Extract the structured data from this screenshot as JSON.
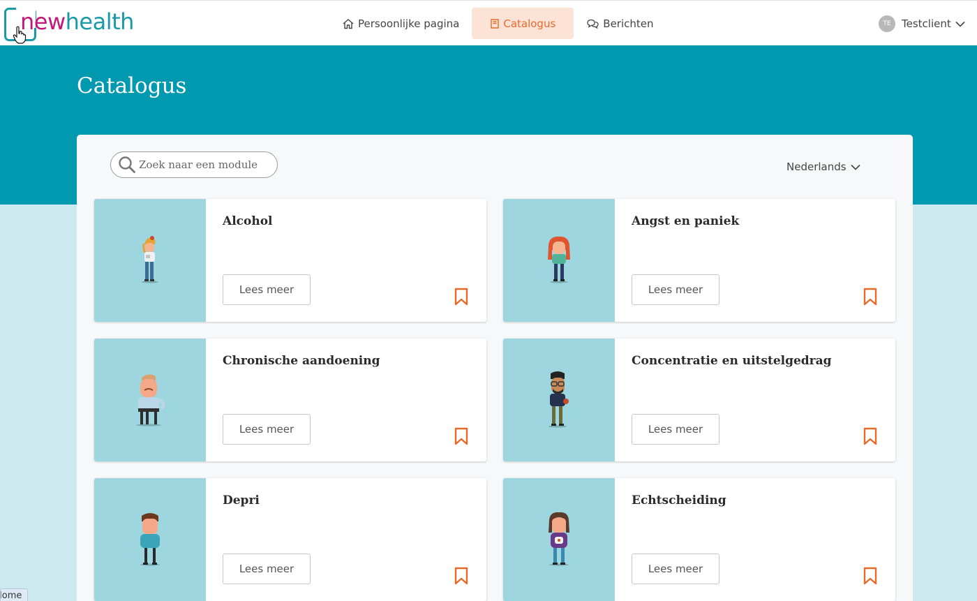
{
  "brand": {
    "part1": "new",
    "part2": "health"
  },
  "nav": [
    {
      "label": "Persoonlijke pagina",
      "icon": "home-icon"
    },
    {
      "label": "Catalogus",
      "icon": "book-icon",
      "active": true
    },
    {
      "label": "Berichten",
      "icon": "chat-icon"
    }
  ],
  "user": {
    "initials": "TE",
    "name": "Testclient"
  },
  "page": {
    "title": "Catalogus"
  },
  "search": {
    "placeholder": "Zoek naar een module"
  },
  "language": {
    "selected": "Nederlands"
  },
  "modules": [
    {
      "title": "Alcohol",
      "button": "Lees meer"
    },
    {
      "title": "Angst en paniek",
      "button": "Lees meer"
    },
    {
      "title": "Chronische aandoening",
      "button": "Lees meer"
    },
    {
      "title": "Concentratie en uitstelgedrag",
      "button": "Lees meer"
    },
    {
      "title": "Depri",
      "button": "Lees meer"
    },
    {
      "title": "Echtscheiding",
      "button": "Lees meer"
    }
  ],
  "footer_tab": {
    "label": "Home"
  },
  "colors": {
    "accent": "#e86a2b",
    "hero": "#0099b0",
    "teal": "#1a9aa8",
    "magenta": "#c2187a",
    "card_image_bg": "#9dd6de"
  }
}
